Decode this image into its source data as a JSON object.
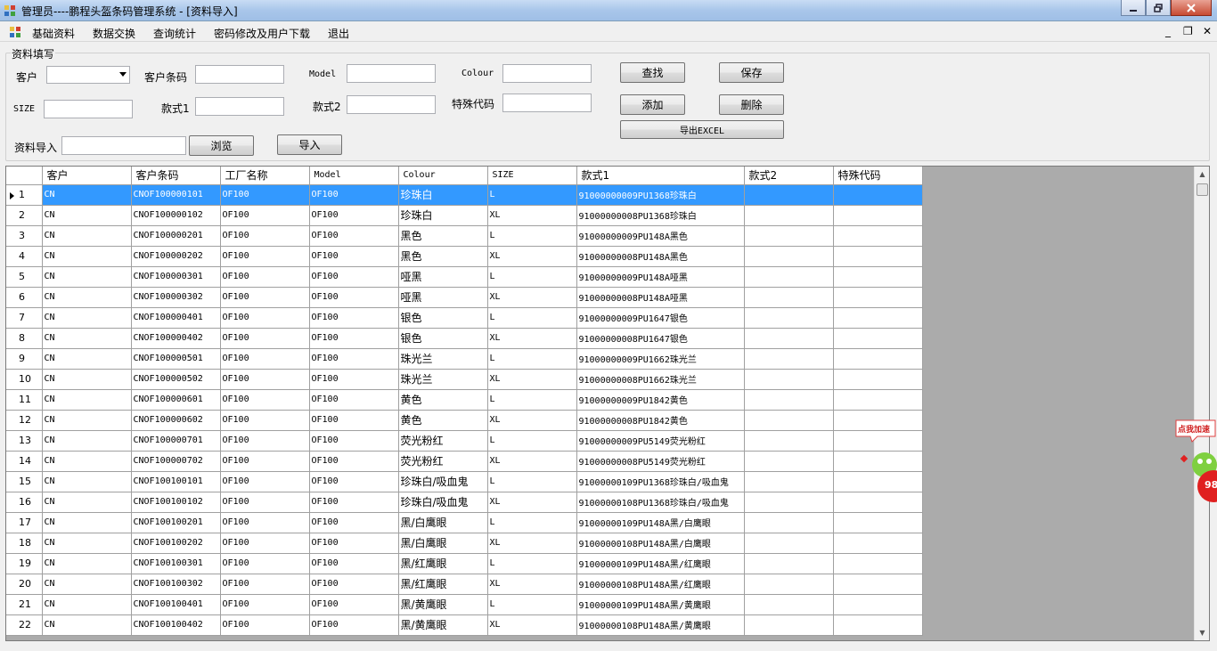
{
  "window": {
    "title": "管理员----鹏程头盔条码管理系统 - [资料导入]"
  },
  "menu": {
    "items": [
      "基础资料",
      "数据交换",
      "查询统计",
      "密码修改及用户下载",
      "退出"
    ]
  },
  "form": {
    "group_title": "资料填写",
    "customer_label": "客户",
    "customer_value": "",
    "customer_barcode_label": "客户条码",
    "model_label": "Model",
    "colour_label": "Colour",
    "size_label": "SIZE",
    "style1_label": "款式1",
    "style2_label": "款式2",
    "special_code_label": "特殊代码",
    "import_label": "资料导入",
    "browse_button": "浏览",
    "import_button": "导入",
    "find_button": "查找",
    "save_button": "保存",
    "add_button": "添加",
    "delete_button": "删除",
    "export_button": "导出EXCEL"
  },
  "grid": {
    "columns": [
      "客户",
      "客户条码",
      "工厂名称",
      "Model",
      "Colour",
      "SIZE",
      "款式1",
      "款式2",
      "特殊代码"
    ],
    "rows": [
      [
        "1",
        "CN",
        "CNOF100000101",
        "OF100",
        "OF100",
        "珍珠白",
        "L",
        "91000000009PU1368珍珠白",
        "",
        ""
      ],
      [
        "2",
        "CN",
        "CNOF100000102",
        "OF100",
        "OF100",
        "珍珠白",
        "XL",
        "91000000008PU1368珍珠白",
        "",
        ""
      ],
      [
        "3",
        "CN",
        "CNOF100000201",
        "OF100",
        "OF100",
        "黑色",
        "L",
        "91000000009PU148A黑色",
        "",
        ""
      ],
      [
        "4",
        "CN",
        "CNOF100000202",
        "OF100",
        "OF100",
        "黑色",
        "XL",
        "91000000008PU148A黑色",
        "",
        ""
      ],
      [
        "5",
        "CN",
        "CNOF100000301",
        "OF100",
        "OF100",
        "哑黑",
        "L",
        "91000000009PU148A哑黑",
        "",
        ""
      ],
      [
        "6",
        "CN",
        "CNOF100000302",
        "OF100",
        "OF100",
        "哑黑",
        "XL",
        "91000000008PU148A哑黑",
        "",
        ""
      ],
      [
        "7",
        "CN",
        "CNOF100000401",
        "OF100",
        "OF100",
        "银色",
        "L",
        "91000000009PU1647银色",
        "",
        ""
      ],
      [
        "8",
        "CN",
        "CNOF100000402",
        "OF100",
        "OF100",
        "银色",
        "XL",
        "91000000008PU1647银色",
        "",
        ""
      ],
      [
        "9",
        "CN",
        "CNOF100000501",
        "OF100",
        "OF100",
        "珠光兰",
        "L",
        "91000000009PU1662珠光兰",
        "",
        ""
      ],
      [
        "10",
        "CN",
        "CNOF100000502",
        "OF100",
        "OF100",
        "珠光兰",
        "XL",
        "91000000008PU1662珠光兰",
        "",
        ""
      ],
      [
        "11",
        "CN",
        "CNOF100000601",
        "OF100",
        "OF100",
        "黄色",
        "L",
        "91000000009PU1842黄色",
        "",
        ""
      ],
      [
        "12",
        "CN",
        "CNOF100000602",
        "OF100",
        "OF100",
        "黄色",
        "XL",
        "91000000008PU1842黄色",
        "",
        ""
      ],
      [
        "13",
        "CN",
        "CNOF100000701",
        "OF100",
        "OF100",
        "荧光粉红",
        "L",
        "91000000009PU5149荧光粉红",
        "",
        ""
      ],
      [
        "14",
        "CN",
        "CNOF100000702",
        "OF100",
        "OF100",
        "荧光粉红",
        "XL",
        "91000000008PU5149荧光粉红",
        "",
        ""
      ],
      [
        "15",
        "CN",
        "CNOF100100101",
        "OF100",
        "OF100",
        "珍珠白/吸血鬼",
        "L",
        "91000000109PU1368珍珠白/吸血鬼",
        "",
        ""
      ],
      [
        "16",
        "CN",
        "CNOF100100102",
        "OF100",
        "OF100",
        "珍珠白/吸血鬼",
        "XL",
        "91000000108PU1368珍珠白/吸血鬼",
        "",
        ""
      ],
      [
        "17",
        "CN",
        "CNOF100100201",
        "OF100",
        "OF100",
        "黑/白鹰眼",
        "L",
        "91000000109PU148A黑/白鹰眼",
        "",
        ""
      ],
      [
        "18",
        "CN",
        "CNOF100100202",
        "OF100",
        "OF100",
        "黑/白鹰眼",
        "XL",
        "91000000108PU148A黑/白鹰眼",
        "",
        ""
      ],
      [
        "19",
        "CN",
        "CNOF100100301",
        "OF100",
        "OF100",
        "黑/红鹰眼",
        "L",
        "91000000109PU148A黑/红鹰眼",
        "",
        ""
      ],
      [
        "20",
        "CN",
        "CNOF100100302",
        "OF100",
        "OF100",
        "黑/红鹰眼",
        "XL",
        "91000000108PU148A黑/红鹰眼",
        "",
        ""
      ],
      [
        "21",
        "CN",
        "CNOF100100401",
        "OF100",
        "OF100",
        "黑/黄鹰眼",
        "L",
        "91000000109PU148A黑/黄鹰眼",
        "",
        ""
      ],
      [
        "22",
        "CN",
        "CNOF100100402",
        "OF100",
        "OF100",
        "黑/黄鹰眼",
        "XL",
        "91000000108PU148A黑/黄鹰眼",
        "",
        ""
      ]
    ],
    "selected_row": 1
  },
  "float_widget": {
    "label": "点我加速",
    "value": "98"
  },
  "colors": {
    "selection": "#3399ff",
    "grid_bg": "#ababab",
    "titlebar": "#a9c6ea"
  }
}
